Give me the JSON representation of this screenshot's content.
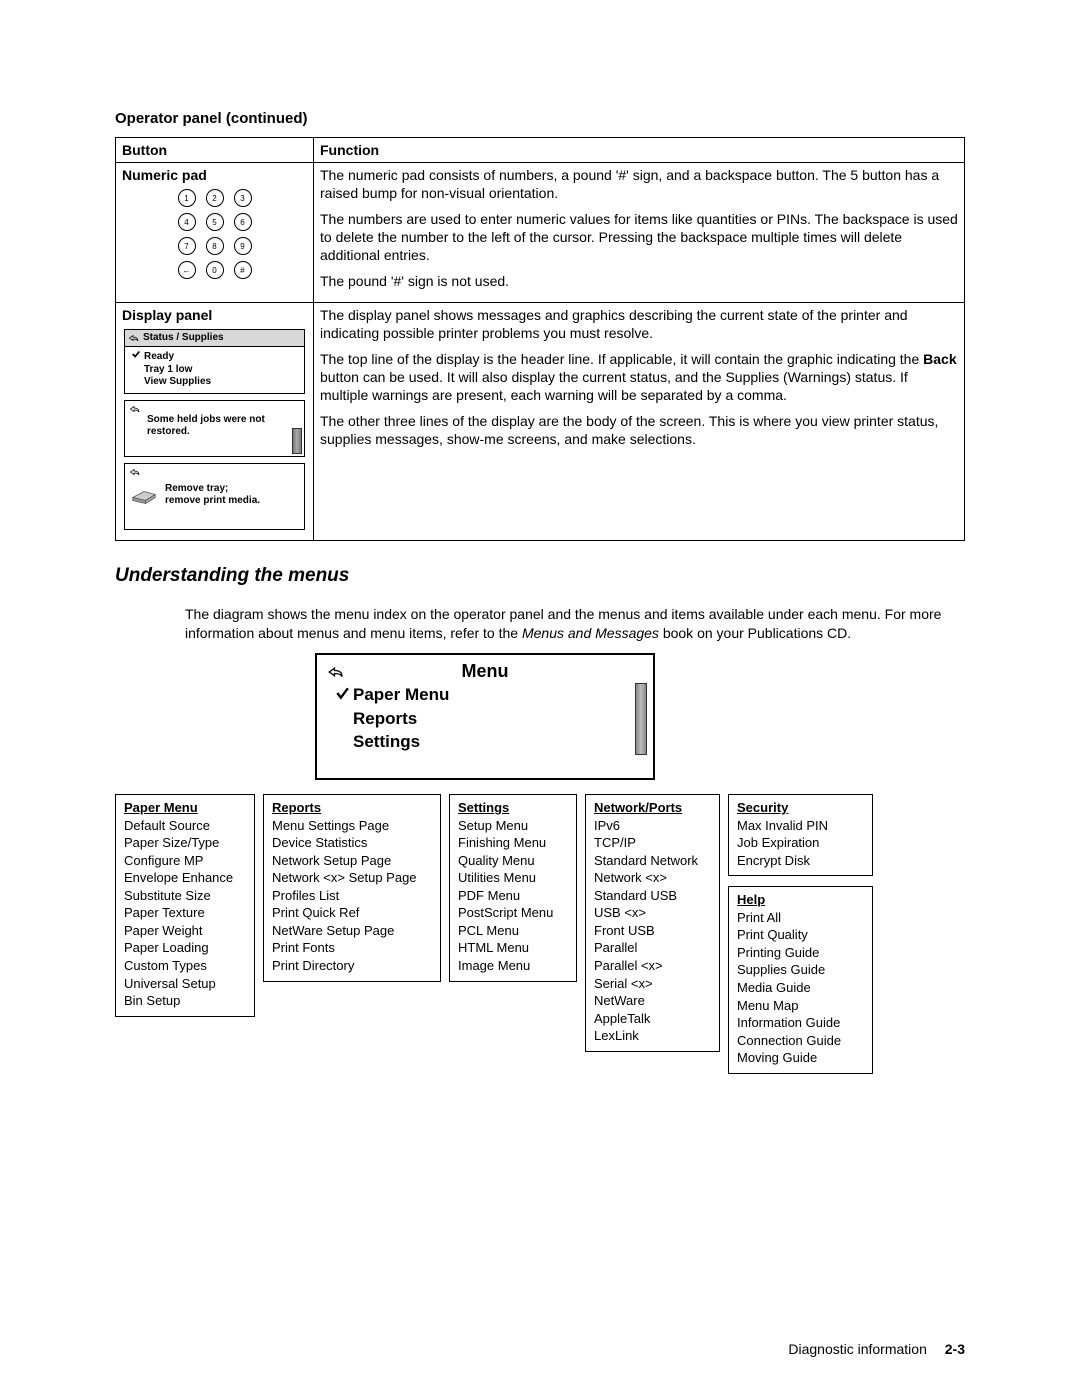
{
  "section_title": "Operator panel (continued)",
  "table": {
    "col1": "Button",
    "col2": "Function",
    "row1_label": "Numeric pad",
    "keypad": [
      "1",
      "2",
      "3",
      "4",
      "5",
      "6",
      "7",
      "8",
      "9",
      "←",
      "0",
      "#"
    ],
    "row1_func_p1": "The numeric pad consists of numbers, a pound '#' sign, and a backspace button. The 5 button has a raised bump for non-visual orientation.",
    "row1_func_p2": "The numbers are used to enter numeric values for items like quantities or PINs. The backspace is used to delete the number to the left of the cursor. Pressing the backspace multiple times will delete additional entries.",
    "row1_func_p3": "The pound '#' sign is not used.",
    "row2_label": "Display panel",
    "disp1_header": "Status / Supplies",
    "disp1_line1": "Ready",
    "disp1_line2": "Tray 1 low",
    "disp1_line3": "View Supplies",
    "disp2_text": "Some held jobs were not restored.",
    "disp3_text1": "Remove tray;",
    "disp3_text2": "remove print media.",
    "row2_func_p1": "The display panel shows messages and graphics describing the current state of the printer and indicating possible printer problems you must resolve.",
    "row2_func_p2a": "The top line of the display is the header line. If applicable, it will contain the graphic indicating the ",
    "row2_func_p2_bold": "Back",
    "row2_func_p2b": " button can be used. It will also display the current status, and the Supplies (Warnings) status. If multiple warnings are present, each warning will be separated by a comma.",
    "row2_func_p3": "The other three lines of the display are the body of the screen. This is where you view printer status, supplies messages, show-me screens, and make selections."
  },
  "subhead": "Understanding the menus",
  "body_p1a": "The diagram shows the menu index on the operator panel and the menus and items available under each menu. For more information about menus and menu items, refer to the ",
  "body_p1_italic": "Menus and Messages",
  "body_p1b": " book on your Publications CD.",
  "menu_display": {
    "header": "Menu",
    "item1": "Paper Menu",
    "item2": "Reports",
    "item3": "Settings"
  },
  "menus": {
    "paper": {
      "title": "Paper Menu",
      "items": [
        "Default Source",
        "Paper Size/Type",
        "Configure MP",
        "Envelope Enhance",
        "Substitute Size",
        "Paper Texture",
        "Paper Weight",
        "Paper Loading",
        "Custom Types",
        "Universal Setup",
        "Bin Setup"
      ]
    },
    "reports": {
      "title": "Reports",
      "items": [
        "Menu Settings Page",
        "Device Statistics",
        "Network Setup Page",
        "Network <x> Setup Page",
        "Profiles List",
        "Print Quick Ref",
        "NetWare Setup Page",
        "Print Fonts",
        "Print Directory"
      ]
    },
    "settings": {
      "title": "Settings",
      "items": [
        "Setup Menu",
        "Finishing Menu",
        "Quality Menu",
        "Utilities Menu",
        "PDF Menu",
        "PostScript Menu",
        "PCL Menu",
        "HTML Menu",
        "Image Menu"
      ]
    },
    "network": {
      "title": "Network/Ports",
      "items": [
        "IPv6",
        "TCP/IP",
        "Standard Network",
        "Network <x>",
        "Standard USB",
        "USB <x>",
        "Front USB",
        "Parallel",
        "Parallel <x>",
        "Serial <x>",
        "NetWare",
        "AppleTalk",
        "LexLink"
      ]
    },
    "security": {
      "title": "Security",
      "items": [
        "Max Invalid PIN",
        "Job Expiration",
        "Encrypt Disk"
      ]
    },
    "help": {
      "title": "Help",
      "items": [
        "Print All",
        "Print Quality",
        "Printing Guide",
        "Supplies Guide",
        "Media Guide",
        "Menu Map",
        "Information Guide",
        "Connection Guide",
        "Moving Guide"
      ]
    }
  },
  "footer": {
    "label": "Diagnostic information",
    "page": "2-3"
  }
}
